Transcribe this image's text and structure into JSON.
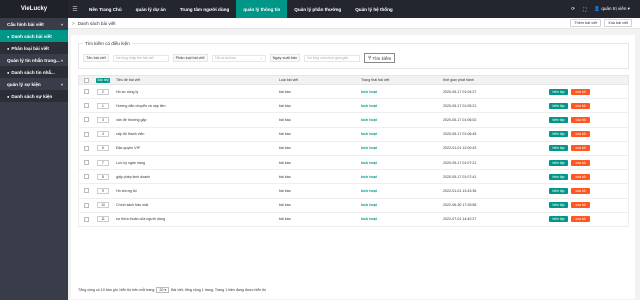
{
  "brand": "VieLucky",
  "nav": [
    "Nền Trang Chủ",
    "quản lý dự án",
    "Trung tâm người dùng",
    "quản lý thông tin",
    "Quản lý phần thưởng",
    "Quản lý hệ thống"
  ],
  "top_right": {
    "user": "quản trị viên"
  },
  "sidebar": {
    "items": [
      {
        "label": "Cấu hình bài viết",
        "type": "group"
      },
      {
        "label": "Danh sách bài viết",
        "type": "sub",
        "active": true
      },
      {
        "label": "Phân loại bài viết",
        "type": "sub"
      },
      {
        "label": "Quản lý tin nhắn trung...",
        "type": "group"
      },
      {
        "label": "Danh sách tin nhắ...",
        "type": "sub"
      },
      {
        "label": "quản lý sự kiện",
        "type": "group"
      },
      {
        "label": "Danh sách sự kiện",
        "type": "sub"
      }
    ]
  },
  "breadcrumb": {
    "lead": ">",
    "current": "Danh sách bài viết"
  },
  "header_actions": [
    "Thêm bài viết",
    "Xóa bài viết"
  ],
  "filter": {
    "legend": "Tìm kiếm có điều kiện",
    "title_label": "Tên bài viết",
    "title_placeholder": "Vui lòng nhập tên bài viết",
    "category_label": "Phân loại bài viết",
    "category_placeholder": "Tất cả bài báo",
    "date_label": "Ngày xuất bản",
    "date_placeholder": "Vui lòng chọn thời gian giải",
    "search_label": "Tìm kiếm"
  },
  "table": {
    "order_button": "Sắp xếp",
    "headers": [
      "Tiêu đề bài viết",
      "Loại bài viết",
      "Trạng thái bài viết",
      "thời gian phát hành"
    ],
    "rows": [
      {
        "order": "2",
        "title": "Hồ sơ công ty",
        "type": "bài báo",
        "status": "kích hoạt",
        "date": "2020-05-17 01:04:27"
      },
      {
        "order": "1",
        "title": "Hướng dẫn chuyển và nạp tiền",
        "type": "bài báo",
        "status": "kích hoạt",
        "date": "2020-05-17 01:05:21"
      },
      {
        "order": "3",
        "title": "vấn đề thường gặp",
        "type": "bài báo",
        "status": "kích hoạt",
        "date": "2020-05-17 01:06:02"
      },
      {
        "order": "4",
        "title": "cấp độ thành viên",
        "type": "bài báo",
        "status": "kích hoạt",
        "date": "2020-05-17 01:06:45"
      },
      {
        "order": "6",
        "title": "Đặc quyền VIP",
        "type": "bài báo",
        "status": "kích hoạt",
        "date": "2022-01-01 12:00:43"
      },
      {
        "order": "7",
        "title": "Lưu ký ngân hàng",
        "type": "bài báo",
        "status": "kích hoạt",
        "date": "2020-05-17 01:07:21"
      },
      {
        "order": "8",
        "title": "giấy phép kinh doanh",
        "type": "bài báo",
        "status": "kích hoạt",
        "date": "2020-05-17 01:07:41"
      },
      {
        "order": "9",
        "title": "Hồ chứng tôi",
        "type": "bài báo",
        "status": "kích hoạt",
        "date": "2022-01-01 13:43:36"
      },
      {
        "order": "10",
        "title": "Chính sách bảo mật",
        "type": "bài báo",
        "status": "kích hoạt",
        "date": "2022-06-30 17:25:56"
      },
      {
        "order": "11",
        "title": "sự thừa thuận của người dùng",
        "type": "bài báo",
        "status": "kích hoạt",
        "date": "2022-07-01 14:42:27"
      }
    ],
    "edit_label": "biên tập",
    "delete_label": "xóa bỏ"
  },
  "pager": {
    "text_before": "Tổng cộng có 10 bản ghi, hiển thị trên mỗi trang",
    "page_size": "20",
    "text_after": "Bài viết, tổng cộng 1 trang, Trang 1 hiện đang được hiển thị"
  },
  "colors": {
    "accent": "#009688",
    "danger": "#ff5722",
    "topbar": "#23262e",
    "sidebar": "#393d49"
  }
}
